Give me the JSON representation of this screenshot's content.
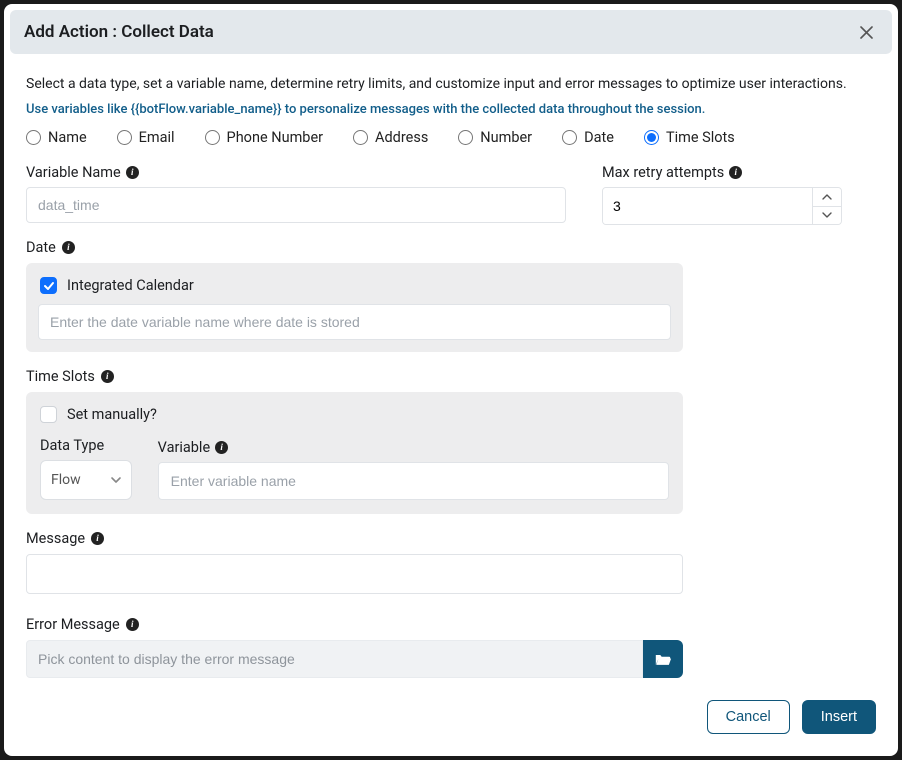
{
  "header": {
    "title": "Add Action : Collect Data"
  },
  "intro": "Select a data type, set a variable name, determine retry limits, and customize input and error messages to optimize user interactions.",
  "hint": "Use variables like {{botFlow.variable_name}} to personalize messages with the collected data throughout the session.",
  "dataTypes": {
    "options": [
      "Name",
      "Email",
      "Phone Number",
      "Address",
      "Number",
      "Date",
      "Time Slots"
    ],
    "selected": "Time Slots"
  },
  "variableName": {
    "label": "Variable Name",
    "placeholder": "data_time",
    "value": ""
  },
  "maxRetry": {
    "label": "Max retry attempts",
    "value": "3"
  },
  "dateSection": {
    "label": "Date",
    "integratedCalendarLabel": "Integrated Calendar",
    "integratedCalendarChecked": true,
    "placeholder": "Enter the date variable name where date is stored"
  },
  "timeSlots": {
    "label": "Time Slots",
    "setManuallyLabel": "Set manually?",
    "setManuallyChecked": false,
    "dataTypeLabel": "Data Type",
    "dataTypeValue": "Flow",
    "variableLabel": "Variable",
    "variablePlaceholder": "Enter variable name"
  },
  "message": {
    "label": "Message"
  },
  "errorMessage": {
    "label": "Error Message",
    "placeholder": "Pick content to display the error message"
  },
  "footer": {
    "cancel": "Cancel",
    "insert": "Insert"
  }
}
